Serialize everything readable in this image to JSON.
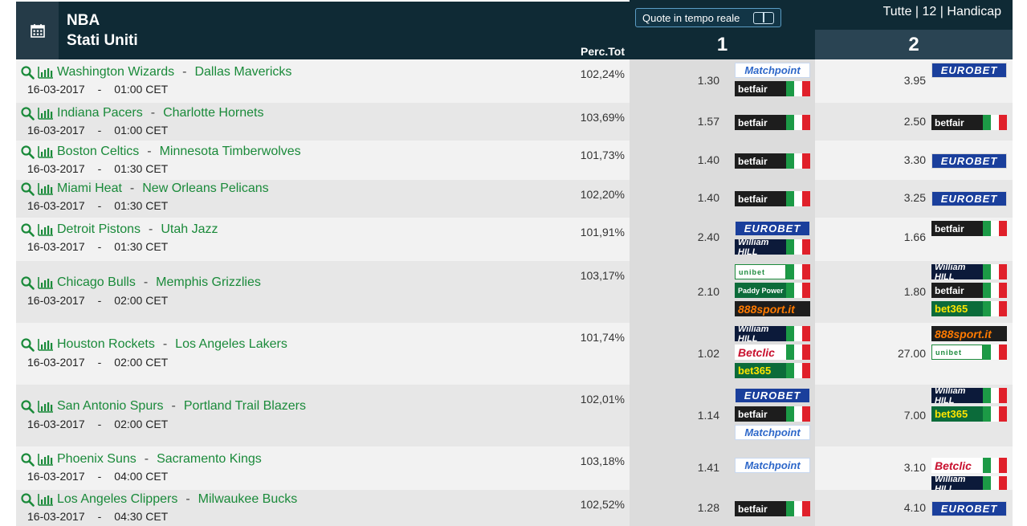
{
  "header": {
    "league": "NBA",
    "country": "Stati Uniti",
    "perc_label": "Perc.Tot",
    "live_button": "Quote in tempo reale",
    "filters": [
      "Tutte",
      "12",
      "Handicap"
    ],
    "filter_sep": "|",
    "col1": "1",
    "col2": "2"
  },
  "icons": {
    "calendar": "calendar-icon",
    "search": "search-icon",
    "stats": "bar-chart-icon"
  },
  "colors": {
    "header_bg": "#0f2a35",
    "team_link": "#1a8a3a",
    "row_odd": "#f2f2f2",
    "row_even": "#e7e7e7"
  },
  "bookmakers": {
    "eurobet": "EUROBET",
    "matchpoint": "Matchpoint",
    "betfair": "betfair",
    "williamhill": "William HILL",
    "unibet": "unibet",
    "paddypower": "Paddy Power",
    "sport888": "888sport.it",
    "betclic": "Betclic",
    "bet365": "bet365"
  },
  "matches": [
    {
      "home": "Washington Wizards",
      "away": "Dallas Mavericks",
      "date": "16-03-2017",
      "time": "01:00 CET",
      "perc": "102,24%",
      "odd1": "1.30",
      "odd2": "3.95",
      "bk1": [
        "matchpoint",
        "betfair"
      ],
      "bk2": [
        "eurobet"
      ]
    },
    {
      "home": "Indiana Pacers",
      "away": "Charlotte Hornets",
      "date": "16-03-2017",
      "time": "01:00 CET",
      "perc": "103,69%",
      "odd1": "1.57",
      "odd2": "2.50",
      "bk1": [
        "betfair"
      ],
      "bk2": [
        "betfair"
      ]
    },
    {
      "home": "Boston Celtics",
      "away": "Minnesota Timberwolves",
      "date": "16-03-2017",
      "time": "01:30 CET",
      "perc": "101,73%",
      "odd1": "1.40",
      "odd2": "3.30",
      "bk1": [
        "betfair"
      ],
      "bk2": [
        "eurobet"
      ]
    },
    {
      "home": "Miami Heat",
      "away": "New Orleans Pelicans",
      "date": "16-03-2017",
      "time": "01:30 CET",
      "perc": "102,20%",
      "odd1": "1.40",
      "odd2": "3.25",
      "bk1": [
        "betfair"
      ],
      "bk2": [
        "eurobet"
      ]
    },
    {
      "home": "Detroit Pistons",
      "away": "Utah Jazz",
      "date": "16-03-2017",
      "time": "01:30 CET",
      "perc": "101,91%",
      "odd1": "2.40",
      "odd2": "1.66",
      "bk1": [
        "eurobet",
        "williamhill"
      ],
      "bk2": [
        "betfair"
      ]
    },
    {
      "home": "Chicago Bulls",
      "away": "Memphis Grizzlies",
      "date": "16-03-2017",
      "time": "02:00 CET",
      "perc": "103,17%",
      "odd1": "2.10",
      "odd2": "1.80",
      "bk1": [
        "unibet",
        "paddypower",
        "sport888"
      ],
      "bk2": [
        "williamhill",
        "betfair",
        "bet365"
      ]
    },
    {
      "home": "Houston Rockets",
      "away": "Los Angeles Lakers",
      "date": "16-03-2017",
      "time": "02:00 CET",
      "perc": "101,74%",
      "odd1": "1.02",
      "odd2": "27.00",
      "bk1": [
        "williamhill",
        "betclic",
        "bet365"
      ],
      "bk2": [
        "sport888",
        "unibet"
      ]
    },
    {
      "home": "San Antonio Spurs",
      "away": "Portland Trail Blazers",
      "date": "16-03-2017",
      "time": "02:00 CET",
      "perc": "102,01%",
      "odd1": "1.14",
      "odd2": "7.00",
      "bk1": [
        "eurobet",
        "betfair",
        "matchpoint"
      ],
      "bk2": [
        "williamhill",
        "bet365"
      ]
    },
    {
      "home": "Phoenix Suns",
      "away": "Sacramento Kings",
      "date": "16-03-2017",
      "time": "04:00 CET",
      "perc": "103,18%",
      "odd1": "1.41",
      "odd2": "3.10",
      "bk1": [
        "matchpoint"
      ],
      "bk2": [
        "betclic",
        "williamhill"
      ]
    },
    {
      "home": "Los Angeles Clippers",
      "away": "Milwaukee Bucks",
      "date": "16-03-2017",
      "time": "04:30 CET",
      "perc": "102,52%",
      "odd1": "1.28",
      "odd2": "4.10",
      "bk1": [
        "betfair"
      ],
      "bk2": [
        "eurobet"
      ]
    }
  ]
}
